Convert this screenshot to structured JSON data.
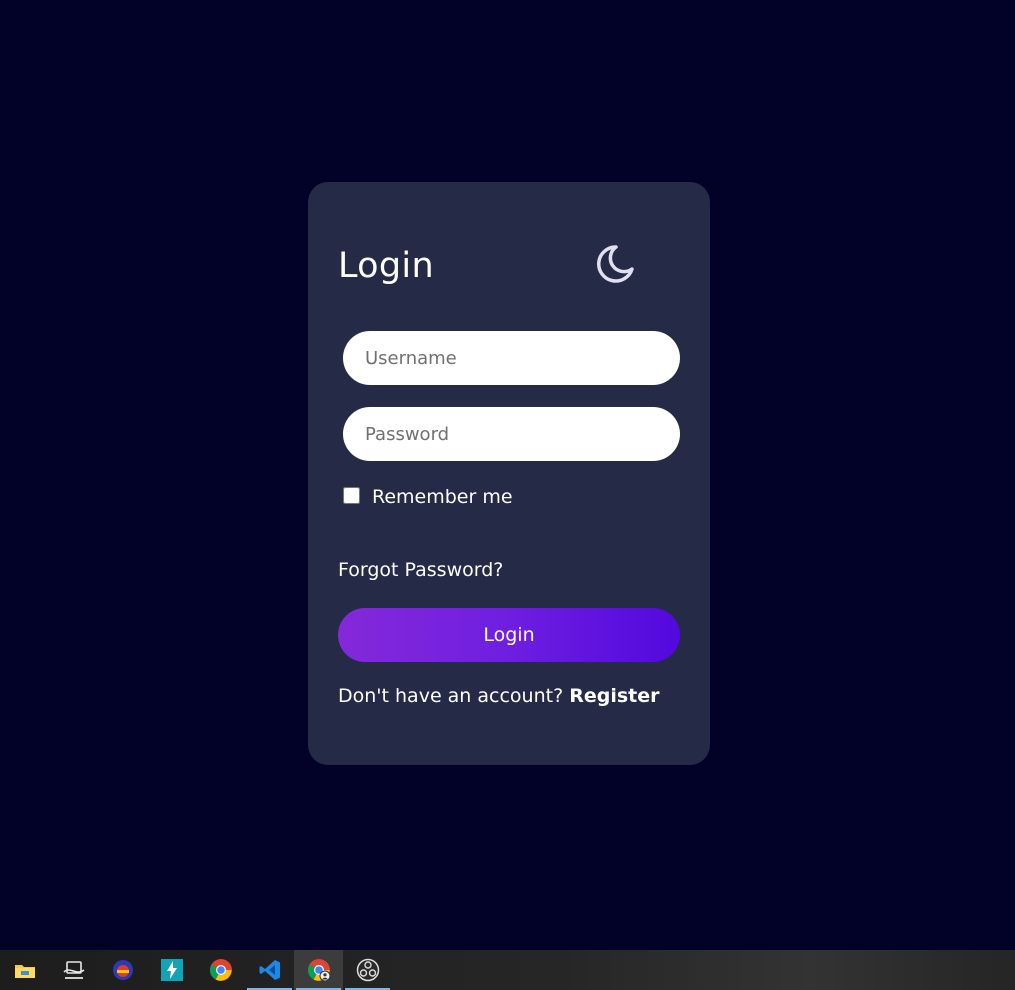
{
  "login": {
    "title": "Login",
    "theme_icon": "moon-icon",
    "username_placeholder": "Username",
    "username_value": "",
    "password_placeholder": "Password",
    "password_value": "",
    "remember_label": "Remember me",
    "remember_checked": false,
    "forgot_label": "Forgot Password?",
    "login_button_label": "Login",
    "register_prompt": "Don't have an account?",
    "register_link": "Register"
  },
  "colors": {
    "background": "#020128",
    "card": "#252a47",
    "button_gradient_start": "#8429d9",
    "button_gradient_end": "#5209de"
  },
  "taskbar": {
    "items": [
      {
        "icon": "file-explorer-icon"
      },
      {
        "icon": "terminal-app-icon"
      },
      {
        "icon": "red-blue-app-icon"
      },
      {
        "icon": "bolt-app-icon"
      },
      {
        "icon": "chrome-icon"
      },
      {
        "icon": "vscode-icon",
        "running": true
      },
      {
        "icon": "chrome-profile-icon",
        "running": true,
        "active": true
      },
      {
        "icon": "obs-icon",
        "running": true
      }
    ]
  }
}
